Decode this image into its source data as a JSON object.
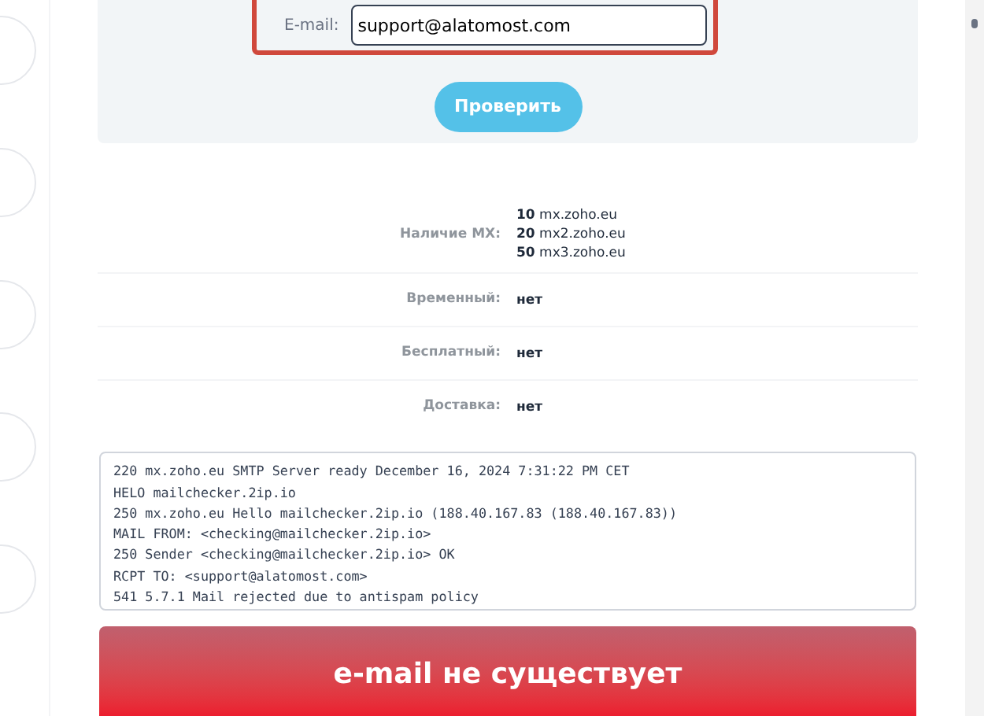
{
  "form": {
    "label": "E-mail:",
    "value": "support@alatomost.com",
    "button": "Проверить"
  },
  "results": [
    {
      "label": "Наличие MX:",
      "values": [
        {
          "priority": "10",
          "host": "mx.zoho.eu"
        },
        {
          "priority": "20",
          "host": "mx2.zoho.eu"
        },
        {
          "priority": "50",
          "host": "mx3.zoho.eu"
        }
      ]
    },
    {
      "label": "Временный:",
      "values": [
        {
          "host": "нет"
        }
      ]
    },
    {
      "label": "Бесплатный:",
      "values": [
        {
          "host": "нет"
        }
      ]
    },
    {
      "label": "Доставка:",
      "values": [
        {
          "host": "нет"
        }
      ]
    }
  ],
  "log": [
    "220 mx.zoho.eu SMTP Server ready December 16, 2024 7:31:22 PM CET",
    "HELO mailchecker.2ip.io",
    "250 mx.zoho.eu Hello mailchecker.2ip.io (188.40.167.83 (188.40.167.83))",
    "MAIL FROM: <checking@mailchecker.2ip.io>",
    "250 Sender <checking@mailchecker.2ip.io> OK",
    "RCPT TO: <support@alatomost.com>",
    "541 5.7.1 Mail rejected due to antispam policy"
  ],
  "verdict": "e-mail не существует"
}
